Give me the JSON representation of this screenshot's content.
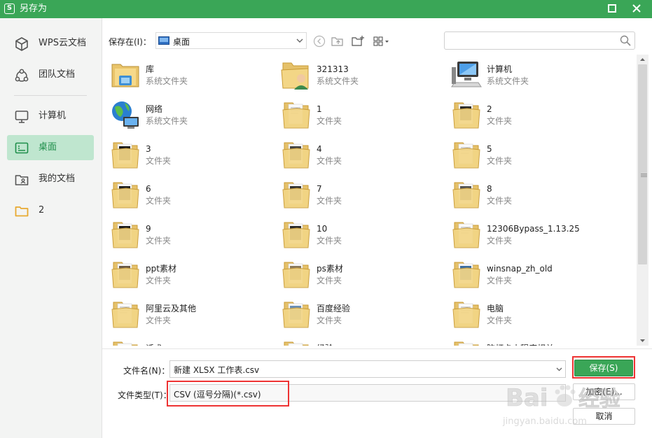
{
  "window": {
    "title": "另存为",
    "accent_color": "#3aa657",
    "icons": {
      "app": "wps-logo-icon",
      "maximize": "maximize-icon",
      "close": "close-icon"
    }
  },
  "sidebar": {
    "items": [
      {
        "label": "WPS云文档",
        "icon": "cloud-cube-icon",
        "active": false
      },
      {
        "label": "团队文档",
        "icon": "team-icon",
        "active": false
      },
      {
        "label": "计算机",
        "icon": "monitor-icon",
        "active": false
      },
      {
        "label": "桌面",
        "icon": "desktop-icon",
        "active": true
      },
      {
        "label": "我的文档",
        "icon": "user-folder-icon",
        "active": false
      },
      {
        "label": "2",
        "icon": "folder-icon",
        "active": false
      }
    ]
  },
  "toolbar": {
    "save_in_label": "保存在(I)：",
    "location": "桌面",
    "location_icon": "desktop-icon",
    "tool_icons": [
      "back-icon",
      "up-folder-icon",
      "new-folder-icon",
      "view-grid-icon"
    ],
    "search_placeholder": "",
    "search_icon": "search-icon"
  },
  "files": [
    {
      "name": "库",
      "type": "系统文件夹",
      "icon": "library-icon"
    },
    {
      "name": "321313",
      "type": "系统文件夹",
      "icon": "user-folder-icon"
    },
    {
      "name": "计算机",
      "type": "系统文件夹",
      "icon": "computer-icon"
    },
    {
      "name": "网络",
      "type": "系统文件夹",
      "icon": "network-globe-icon"
    },
    {
      "name": "1",
      "type": "文件夹",
      "icon": "folder-icon"
    },
    {
      "name": "2",
      "type": "文件夹",
      "icon": "folder-icon"
    },
    {
      "name": "3",
      "type": "文件夹",
      "icon": "folder-icon"
    },
    {
      "name": "4",
      "type": "文件夹",
      "icon": "folder-icon"
    },
    {
      "name": "5",
      "type": "文件夹",
      "icon": "folder-icon"
    },
    {
      "name": "6",
      "type": "文件夹",
      "icon": "folder-icon"
    },
    {
      "name": "7",
      "type": "文件夹",
      "icon": "folder-icon"
    },
    {
      "name": "8",
      "type": "文件夹",
      "icon": "folder-icon"
    },
    {
      "name": "9",
      "type": "文件夹",
      "icon": "folder-icon"
    },
    {
      "name": "10",
      "type": "文件夹",
      "icon": "folder-icon"
    },
    {
      "name": "12306Bypass_1.13.25",
      "type": "文件夹",
      "icon": "folder-icon"
    },
    {
      "name": "ppt素材",
      "type": "文件夹",
      "icon": "folder-icon"
    },
    {
      "name": "ps素材",
      "type": "文件夹",
      "icon": "folder-icon"
    },
    {
      "name": "winsnap_zh_old",
      "type": "文件夹",
      "icon": "folder-icon"
    },
    {
      "name": "阿里云及其他",
      "type": "文件夹",
      "icon": "folder-icon"
    },
    {
      "name": "百度经验",
      "type": "文件夹",
      "icon": "folder-icon"
    },
    {
      "name": "电脑",
      "type": "文件夹",
      "icon": "folder-icon"
    },
    {
      "name": "话术",
      "type": "",
      "icon": "folder-icon"
    },
    {
      "name": "经验",
      "type": "",
      "icon": "folder-icon"
    },
    {
      "name": "脑灯卡小程序相关",
      "type": "",
      "icon": "folder-icon"
    }
  ],
  "form": {
    "filename_label": "文件名(N)：",
    "filename_value": "新建 XLSX 工作表.csv",
    "filetype_label": "文件类型(T)：",
    "filetype_value": "CSV (逗号分隔)(*.csv)"
  },
  "buttons": {
    "save": "保存(S)",
    "encrypt": "加密(E)...",
    "cancel": "取消"
  },
  "highlight_color": "#e33333",
  "watermark": {
    "brand": "Baidu经验",
    "url": "jingyan.baidu.com"
  }
}
